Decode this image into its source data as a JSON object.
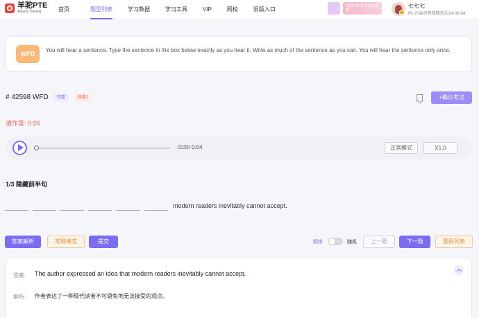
{
  "header": {
    "logo_title": "羊驼PTE",
    "logo_sub": "Alpaca Training",
    "nav": [
      {
        "label": "首页",
        "active": false
      },
      {
        "label": "题型列表",
        "active": true
      },
      {
        "label": "学习数据",
        "active": false
      },
      {
        "label": "学习工具",
        "active": false
      },
      {
        "label": "VIP",
        "active": false
      },
      {
        "label": "网校",
        "active": false
      },
      {
        "label": "旧版入口",
        "active": false
      }
    ],
    "banner_text": "羊驼PTE 学习 提分攻略",
    "user_name": "七七七",
    "user_status": "PLUS会员有效期至2024-08-04"
  },
  "instruction": {
    "badge": "WFD",
    "text": "You will hear a sentence. Type the sentence in the box below exactly as you hear it. Write as much of the sentence as you can. You will hear the sentence only once."
  },
  "question": {
    "id": "# 42598 WFD",
    "tag_difficulty": "完整",
    "tag_hot": "热度1",
    "exam_button": "+确认考过",
    "countdown": "请作答: 0:26"
  },
  "player": {
    "time": "0:00/ 0:04",
    "progress": 0,
    "mode": "正常模式",
    "speed": "X1.0"
  },
  "section": {
    "title": "1/3 隐藏前半句",
    "blank_count": 6,
    "sentence_tail": "modern readers inevitably cannot accept."
  },
  "actions": {
    "analysis": "答案解析",
    "normal_mode": "常规模式",
    "submit": "提交",
    "order": "顺序",
    "random": "随机",
    "prev": "上一题",
    "next": "下一题",
    "list": "题目列表"
  },
  "answer": {
    "answer_label": "答案:",
    "answer_text": "The author expressed an idea that modern readers inevitably cannot accept.",
    "explain_label": "解析:",
    "explain_text": "作者表达了一种现代读者不可避免地无法接受的观点。"
  },
  "colors": {
    "accent": "#7b6df2",
    "warning": "#e85d5d",
    "orange": "#fbb878"
  }
}
